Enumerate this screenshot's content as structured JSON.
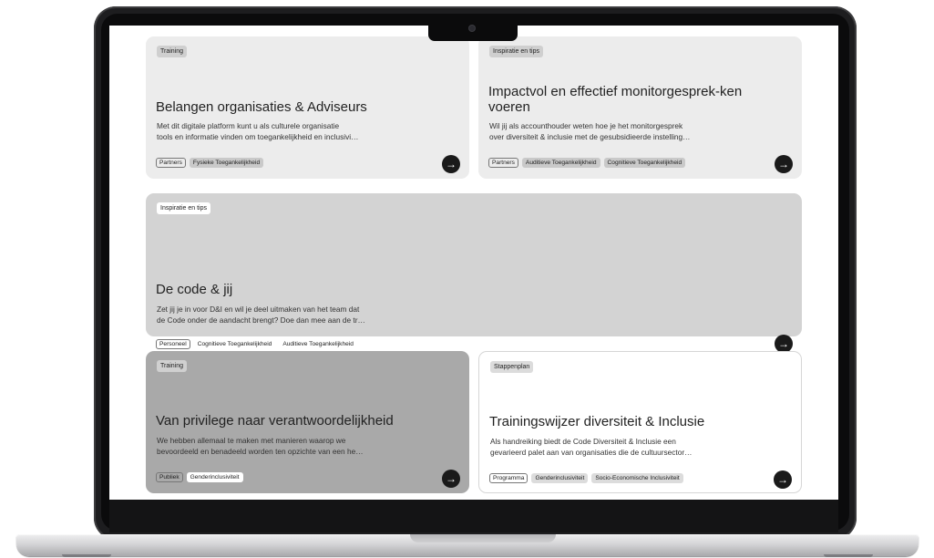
{
  "cards": [
    {
      "category": "Training",
      "title": "Belangen organisaties & Adviseurs",
      "desc": [
        "Met dit digitale platform kunt u als culturele organisatie",
        "tools en informatie vinden om toegankelijkheid en inclusivi…"
      ],
      "audience": "Partners",
      "tags": [
        "Fysieke Toegankelijkheid"
      ]
    },
    {
      "category": "Inspiratie en tips",
      "title": "Impactvol en effectief monitorgesprek-ken voeren",
      "desc": [
        "Wil jij als accounthouder weten hoe je het monitorgesprek",
        "over diversiteit & inclusie met de gesubsidieerde instelling…"
      ],
      "audience": "Partners",
      "tags": [
        "Auditieve Toegankelijkheid",
        "Cognitieve Toegankelijkheid"
      ]
    },
    {
      "category": "Inspiratie en tips",
      "title": "De code & jij",
      "desc": [
        "Zet jij je in voor D&I en wil je deel uitmaken van het team dat",
        "de Code onder de aandacht brengt? Doe dan mee aan de tr…"
      ],
      "audience": "Personeel",
      "tags": [
        "Cognitieve Toegankelijkheid",
        "Auditieve Toegankelijkheid"
      ]
    },
    {
      "category": "Training",
      "title": "Van privilege naar verantwoordelijkheid",
      "desc": [
        "We hebben allemaal te maken met manieren waarop we",
        "bevoordeeld en benadeeld worden ten opzichte van een he…"
      ],
      "audience": "Publiek",
      "tags": [
        "Genderinclusiviteit"
      ]
    },
    {
      "category": "Stappenplan",
      "title": "Trainingswijzer diversiteit & Inclusie",
      "desc": [
        "Als handreiking biedt de Code Diversiteit & Inclusie een",
        "gevarieerd palet aan van organisaties die de cultuursector…"
      ],
      "audience": "Programma",
      "tags": [
        "Genderinclusiviteit",
        "Socio-Economische Inclusiviteit"
      ]
    }
  ],
  "arrow_glyph": "→",
  "icons": {
    "arrow": "arrow-right-icon",
    "camera": "camera-icon"
  },
  "colors": {
    "card_light": "#ececec",
    "card_mid": "#d3d3d3",
    "card_dark": "#a9a9a9",
    "card_white": "#ffffff",
    "button": "#1a1a1a",
    "laptop_frame": "#1d1d1f"
  }
}
